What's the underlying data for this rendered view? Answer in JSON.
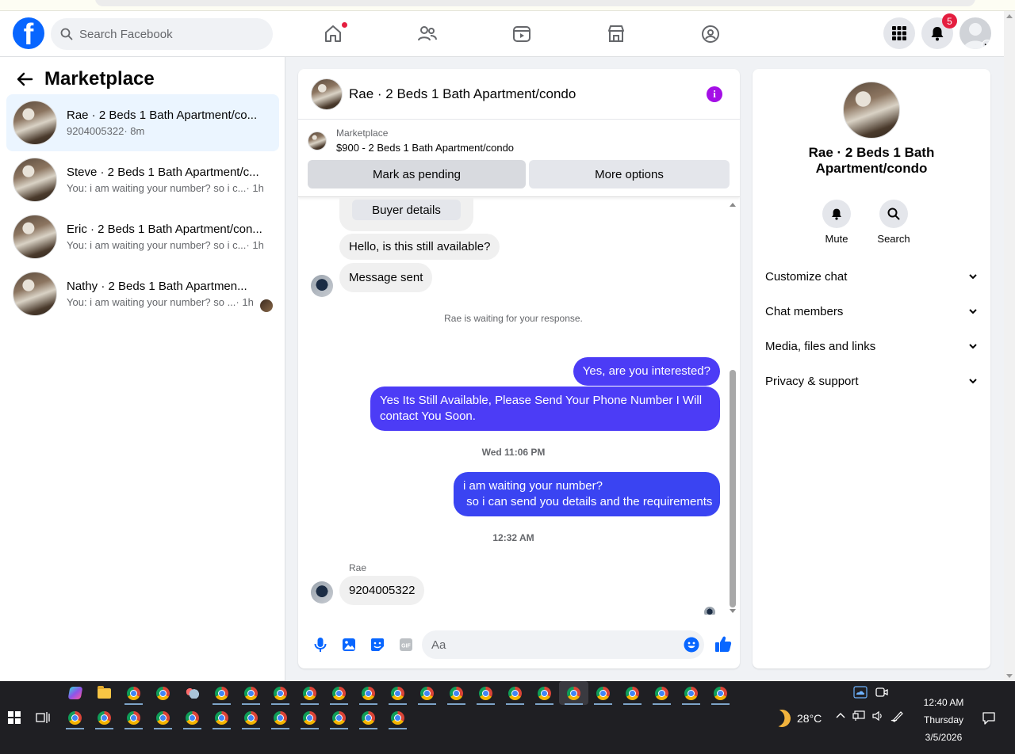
{
  "topnav": {
    "search_placeholder": "Search Facebook",
    "notification_count": "5",
    "logo_letter": "f"
  },
  "left": {
    "title": "Marketplace",
    "conversations": [
      {
        "title": "Rae · 2 Beds 1 Bath Apartment/co...",
        "msg": "9204005322",
        "time": " · 8m",
        "active": true
      },
      {
        "title": "Steve · 2 Beds 1 Bath Apartment/c...",
        "msg": "You: i am waiting your number? so i c...",
        "time": " · 1h"
      },
      {
        "title": "Eric · 2 Beds 1 Bath Apartment/con...",
        "msg": "You: i am waiting your number? so i c...",
        "time": " · 1h"
      },
      {
        "title": "Nathy · 2 Beds 1 Bath Apartmen...",
        "msg": "You: i am waiting your number? so ...",
        "time": " · 1h"
      }
    ]
  },
  "chat": {
    "title": "Rae · 2 Beds 1 Bath Apartment/condo",
    "listing_category": "Marketplace",
    "listing_price": "$900 - 2 Beds 1 Bath Apartment/condo",
    "mark_pending": "Mark as pending",
    "more_options": "More options",
    "buyer_details": "Buyer details",
    "msg_available": "Hello, is this still available?",
    "msg_sent": "Message sent",
    "waiting_note": "Rae is waiting for your response.",
    "out_interested": "Yes, are you interested?",
    "out_still_available": "Yes Its Still Available, Please Send Your Phone Number I Will contact You Soon.",
    "time_1": "Wed 11:06 PM",
    "out_waiting_line1": "i am waiting your number?",
    "out_waiting_line2": " so i can send you details and the requirements",
    "time_2": "12:32 AM",
    "sender": "Rae",
    "in_number": "9204005322",
    "composer_placeholder": "Aa"
  },
  "right": {
    "title": "Rae · 2 Beds 1 Bath Apartment/condo",
    "mute": "Mute",
    "search": "Search",
    "sections": [
      "Customize chat",
      "Chat members",
      "Media, files and links",
      "Privacy & support"
    ]
  },
  "taskbar": {
    "temperature": "28°C",
    "time": "12:40 AM",
    "day": "Thursday",
    "date": "3/5/2026"
  },
  "colors": {
    "brand_blue": "#0866ff",
    "outgoing_bubble": "#4c3cf6",
    "info_purple": "#a40fe6",
    "badge_red": "#e41e3f"
  },
  "icons": [
    "facebook-logo",
    "search-icon",
    "home-icon",
    "friends-icon",
    "video-icon",
    "marketplace-icon",
    "groups-icon",
    "menu-grid-icon",
    "bell-icon",
    "profile-icon",
    "back-arrow-icon",
    "info-icon",
    "mic-icon",
    "image-icon",
    "sticker-icon",
    "gif-icon",
    "emoji-icon",
    "thumbs-up-icon",
    "chevron-down-icon"
  ]
}
